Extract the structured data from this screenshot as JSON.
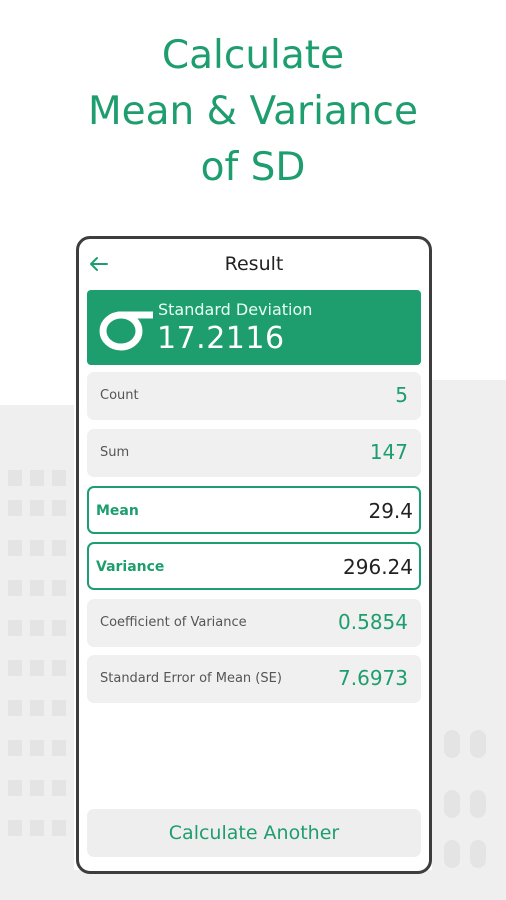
{
  "headline": {
    "line1": "Calculate",
    "line2": "Mean & Variance",
    "line3": "of SD"
  },
  "colors": {
    "accent": "#1e9e6e",
    "frame": "#3d3d3d",
    "row_bg": "#f0f0f0"
  },
  "screen": {
    "title": "Result",
    "back_icon": "arrow-left-icon",
    "sd": {
      "icon": "sigma-icon",
      "label": "Standard Deviation",
      "value": "17.2116"
    },
    "rows": [
      {
        "label": "Count",
        "value": "5"
      },
      {
        "label": "Sum",
        "value": "147"
      },
      {
        "label": "Mean",
        "value": "29.4"
      },
      {
        "label": "Variance",
        "value": "296.24"
      },
      {
        "label": "Coefficient of Variance",
        "value": "0.5854"
      },
      {
        "label": "Standard Error of Mean (SE)",
        "value": "7.6973"
      }
    ],
    "button_label": "Calculate Another"
  }
}
